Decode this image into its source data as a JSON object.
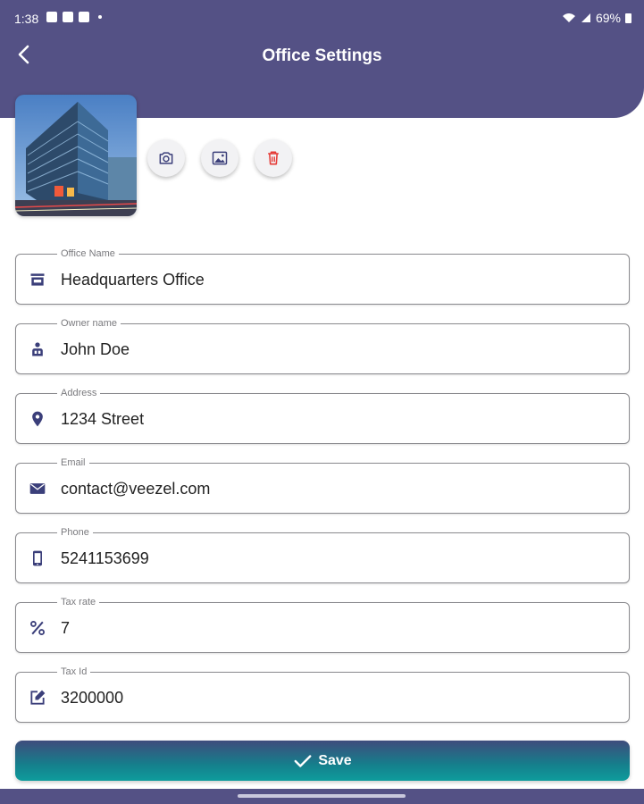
{
  "status_bar": {
    "time": "1:38",
    "battery": "69%"
  },
  "app_bar": {
    "title": "Office Settings"
  },
  "photo_actions": {
    "camera": "camera-icon",
    "gallery": "image-icon",
    "delete": "trash-icon"
  },
  "fields": [
    {
      "label": "Office Name",
      "value": "Headquarters Office",
      "icon": "store-icon"
    },
    {
      "label": "Owner name",
      "value": "John Doe",
      "icon": "person-badge-icon"
    },
    {
      "label": "Address",
      "value": "1234 Street",
      "icon": "location-pin-icon"
    },
    {
      "label": "Email",
      "value": "contact@veezel.com",
      "icon": "envelope-icon"
    },
    {
      "label": "Phone",
      "value": "5241153699",
      "icon": "phone-icon"
    },
    {
      "label": "Tax rate",
      "value": "7",
      "icon": "percent-icon"
    },
    {
      "label": "Tax Id",
      "value": "3200000",
      "icon": "edit-icon"
    }
  ],
  "save_button": {
    "label": "Save"
  },
  "colors": {
    "primary": "#545185",
    "accent": "#0e9c9c",
    "delete": "#e53935",
    "icon": "#3b3f7a"
  }
}
